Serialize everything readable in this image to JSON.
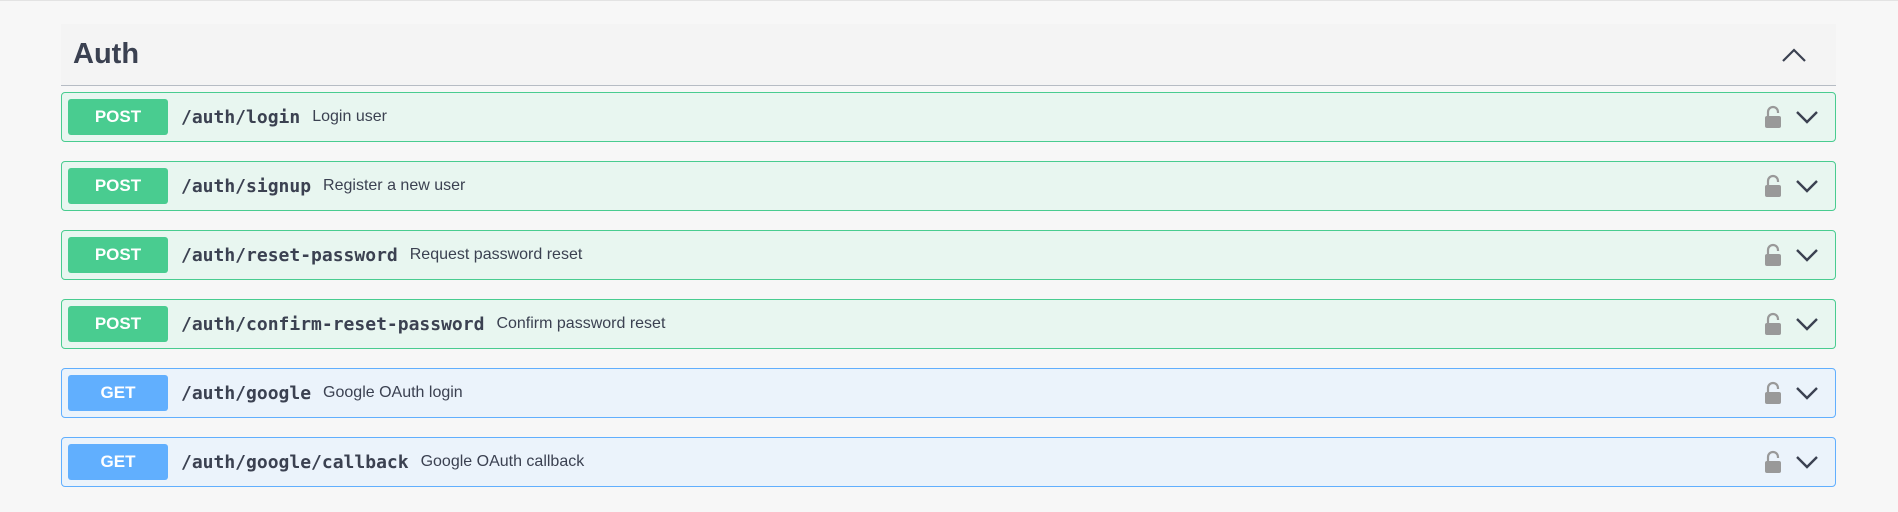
{
  "section": {
    "title": "Auth",
    "toggle_icon": "chevron-up-icon"
  },
  "colors": {
    "post": "#49cc90",
    "post_bg": "#e8f6f0",
    "get": "#61affe",
    "get_bg": "#ebf3fb",
    "text": "#3b4151",
    "lock": "#999999"
  },
  "operations": [
    {
      "method": "POST",
      "path": "/auth/login",
      "summary": "Login user"
    },
    {
      "method": "POST",
      "path": "/auth/signup",
      "summary": "Register a new user"
    },
    {
      "method": "POST",
      "path": "/auth/reset-password",
      "summary": "Request password reset"
    },
    {
      "method": "POST",
      "path": "/auth/confirm-reset-password",
      "summary": "Confirm password reset"
    },
    {
      "method": "GET",
      "path": "/auth/google",
      "summary": "Google OAuth login"
    },
    {
      "method": "GET",
      "path": "/auth/google/callback",
      "summary": "Google OAuth callback"
    }
  ],
  "icons": {
    "lock": "lock-icon",
    "expand": "chevron-down-icon"
  }
}
